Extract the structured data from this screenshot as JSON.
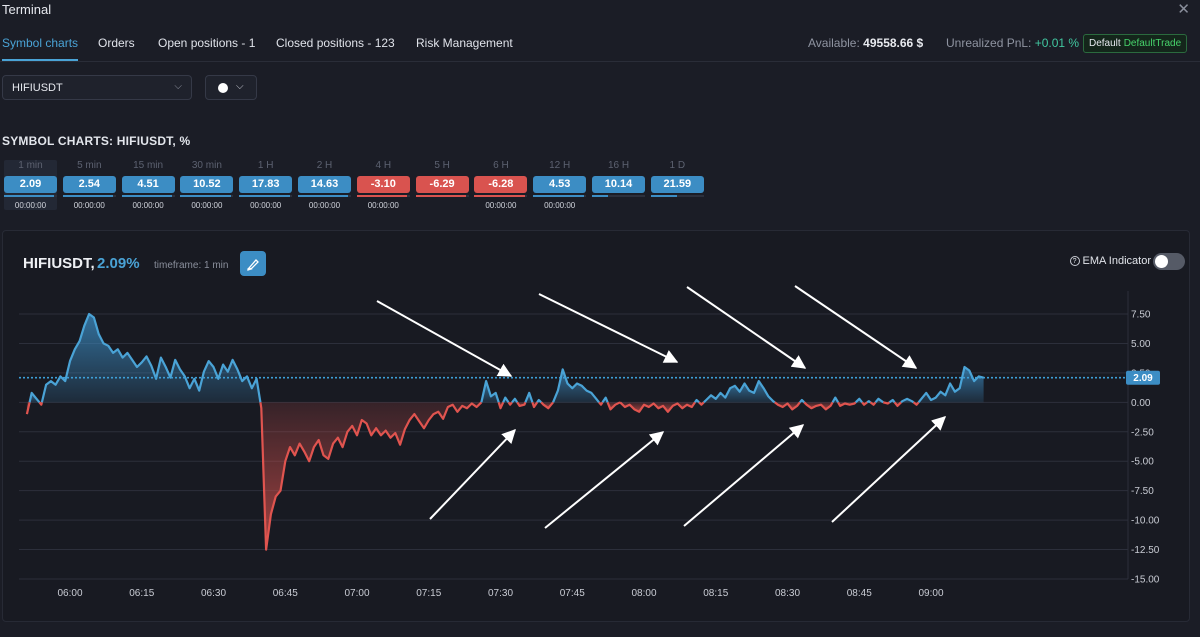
{
  "window": {
    "title": "Terminal"
  },
  "tabs": [
    {
      "label": "Symbol charts",
      "active": true
    },
    {
      "label": "Orders",
      "active": false
    },
    {
      "label": "Open positions - 1",
      "active": false
    },
    {
      "label": "Closed positions - 123",
      "active": false
    },
    {
      "label": "Risk Management",
      "active": false
    }
  ],
  "account": {
    "available_label": "Available:",
    "available_value": "49558.66 $",
    "pnl_label": "Unrealized PnL:",
    "pnl_value": "+0.01 %",
    "badge_default": "Default",
    "badge_trade": "DefaultTrade"
  },
  "symbol_select": {
    "value": "HIFIUSDT"
  },
  "section_title": "SYMBOL CHARTS: HIFIUSDT, %",
  "timeframes": [
    {
      "label": "1 min",
      "value": "2.09",
      "time": "00:00:00",
      "sign": "pos",
      "fill": 0.95
    },
    {
      "label": "5 min",
      "value": "2.54",
      "time": "00:00:00",
      "sign": "pos",
      "fill": 0.95
    },
    {
      "label": "15 min",
      "value": "4.51",
      "time": "00:00:00",
      "sign": "pos",
      "fill": 0.95
    },
    {
      "label": "30 min",
      "value": "10.52",
      "time": "00:00:00",
      "sign": "pos",
      "fill": 0.95
    },
    {
      "label": "1 H",
      "value": "17.83",
      "time": "00:00:00",
      "sign": "pos",
      "fill": 0.95
    },
    {
      "label": "2 H",
      "value": "14.63",
      "time": "00:00:00",
      "sign": "pos",
      "fill": 0.95
    },
    {
      "label": "4 H",
      "value": "-3.10",
      "time": "00:00:00",
      "sign": "neg",
      "fill": 0.95
    },
    {
      "label": "5 H",
      "value": "-6.29",
      "time": "",
      "sign": "neg",
      "fill": 0.95
    },
    {
      "label": "6 H",
      "value": "-6.28",
      "time": "00:00:00",
      "sign": "neg",
      "fill": 0.95
    },
    {
      "label": "12 H",
      "value": "4.53",
      "time": "00:00:00",
      "sign": "pos",
      "fill": 0.95
    },
    {
      "label": "16 H",
      "value": "10.14",
      "time": "",
      "sign": "pos",
      "fill": 0.3
    },
    {
      "label": "1 D",
      "value": "21.59",
      "time": "",
      "sign": "pos",
      "fill": 0.5
    }
  ],
  "chart_header": {
    "symbol": "HIFIUSDT,",
    "percent": "2.09%",
    "timeframe_label": "timeframe: 1 min",
    "ema_label": "EMA Indicator"
  },
  "colors": {
    "accent": "#3c8dc4",
    "positive": "#4aa3d6",
    "negative": "#e0544f",
    "pnl_positive": "#41c7a0"
  },
  "icons": [
    "close-icon",
    "chevron-down-icon",
    "pen-icon",
    "help-icon"
  ],
  "chart_data": {
    "type": "area",
    "title": "",
    "xlabel": "",
    "ylabel": "",
    "ylim": [
      -15,
      7.5
    ],
    "yticks": [
      "7.50",
      "5.00",
      "2.50",
      "0.00",
      "-2.50",
      "-5.00",
      "-7.50",
      "-10.00",
      "-12.50",
      "-15.00"
    ],
    "xticks": [
      "06:00",
      "06:15",
      "06:30",
      "06:45",
      "07:00",
      "07:15",
      "07:30",
      "07:45",
      "08:00",
      "08:15",
      "08:30",
      "08:45",
      "09:00"
    ],
    "current_value": 2.09,
    "current_label": "2.09",
    "grid": true,
    "series": [
      {
        "values": [
          {
            "t": "05:51",
            "v": -1.0
          },
          {
            "t": "05:52",
            "v": 0.8
          },
          {
            "t": "05:53",
            "v": 0.3
          },
          {
            "t": "05:54",
            "v": -0.2
          },
          {
            "t": "05:55",
            "v": 1.5
          },
          {
            "t": "05:56",
            "v": 1.8
          },
          {
            "t": "05:57",
            "v": 1.5
          },
          {
            "t": "05:58",
            "v": 2.2
          },
          {
            "t": "05:59",
            "v": 1.8
          },
          {
            "t": "06:00",
            "v": 3.5
          },
          {
            "t": "06:01",
            "v": 4.5
          },
          {
            "t": "06:02",
            "v": 5.2
          },
          {
            "t": "06:03",
            "v": 6.5
          },
          {
            "t": "06:04",
            "v": 7.5
          },
          {
            "t": "06:05",
            "v": 7.2
          },
          {
            "t": "06:06",
            "v": 5.8
          },
          {
            "t": "06:07",
            "v": 5.0
          },
          {
            "t": "06:08",
            "v": 4.8
          },
          {
            "t": "06:09",
            "v": 4.2
          },
          {
            "t": "06:10",
            "v": 4.5
          },
          {
            "t": "06:11",
            "v": 3.8
          },
          {
            "t": "06:12",
            "v": 4.2
          },
          {
            "t": "06:13",
            "v": 3.6
          },
          {
            "t": "06:14",
            "v": 3.0
          },
          {
            "t": "06:15",
            "v": 3.4
          },
          {
            "t": "06:16",
            "v": 3.9
          },
          {
            "t": "06:17",
            "v": 3.1
          },
          {
            "t": "06:18",
            "v": 2.0
          },
          {
            "t": "06:19",
            "v": 3.8
          },
          {
            "t": "06:20",
            "v": 3.0
          },
          {
            "t": "06:21",
            "v": 2.1
          },
          {
            "t": "06:22",
            "v": 3.6
          },
          {
            "t": "06:23",
            "v": 2.8
          },
          {
            "t": "06:24",
            "v": 2.2
          },
          {
            "t": "06:25",
            "v": 1.2
          },
          {
            "t": "06:26",
            "v": 2.0
          },
          {
            "t": "06:27",
            "v": 1.0
          },
          {
            "t": "06:28",
            "v": 2.6
          },
          {
            "t": "06:29",
            "v": 3.5
          },
          {
            "t": "06:30",
            "v": 3.0
          },
          {
            "t": "06:31",
            "v": 2.0
          },
          {
            "t": "06:32",
            "v": 3.2
          },
          {
            "t": "06:33",
            "v": 2.6
          },
          {
            "t": "06:34",
            "v": 3.6
          },
          {
            "t": "06:35",
            "v": 2.8
          },
          {
            "t": "06:36",
            "v": 1.8
          },
          {
            "t": "06:37",
            "v": 2.2
          },
          {
            "t": "06:38",
            "v": 1.2
          },
          {
            "t": "06:39",
            "v": 2.0
          },
          {
            "t": "06:40",
            "v": -0.5
          },
          {
            "t": "06:41",
            "v": -12.5
          },
          {
            "t": "06:42",
            "v": -9.5
          },
          {
            "t": "06:43",
            "v": -8.0
          },
          {
            "t": "06:44",
            "v": -7.5
          },
          {
            "t": "06:45",
            "v": -5.0
          },
          {
            "t": "06:46",
            "v": -3.8
          },
          {
            "t": "06:47",
            "v": -4.5
          },
          {
            "t": "06:48",
            "v": -3.5
          },
          {
            "t": "06:49",
            "v": -4.2
          },
          {
            "t": "06:50",
            "v": -5.0
          },
          {
            "t": "06:51",
            "v": -3.8
          },
          {
            "t": "06:52",
            "v": -3.2
          },
          {
            "t": "06:53",
            "v": -4.5
          },
          {
            "t": "06:54",
            "v": -4.8
          },
          {
            "t": "06:55",
            "v": -3.5
          },
          {
            "t": "06:56",
            "v": -3.0
          },
          {
            "t": "06:57",
            "v": -3.8
          },
          {
            "t": "06:58",
            "v": -2.5
          },
          {
            "t": "06:59",
            "v": -2.0
          },
          {
            "t": "07:00",
            "v": -2.8
          },
          {
            "t": "07:01",
            "v": -1.5
          },
          {
            "t": "07:02",
            "v": -1.8
          },
          {
            "t": "07:03",
            "v": -2.8
          },
          {
            "t": "07:04",
            "v": -2.2
          },
          {
            "t": "07:05",
            "v": -2.8
          },
          {
            "t": "07:06",
            "v": -2.4
          },
          {
            "t": "07:07",
            "v": -3.0
          },
          {
            "t": "07:08",
            "v": -2.6
          },
          {
            "t": "07:09",
            "v": -3.6
          },
          {
            "t": "07:10",
            "v": -2.3
          },
          {
            "t": "07:11",
            "v": -1.5
          },
          {
            "t": "07:12",
            "v": -1.0
          },
          {
            "t": "07:13",
            "v": -1.6
          },
          {
            "t": "07:14",
            "v": -2.2
          },
          {
            "t": "07:15",
            "v": -1.5
          },
          {
            "t": "07:16",
            "v": -1.0
          },
          {
            "t": "07:17",
            "v": -0.8
          },
          {
            "t": "07:18",
            "v": -1.4
          },
          {
            "t": "07:19",
            "v": -0.4
          },
          {
            "t": "07:20",
            "v": -0.2
          },
          {
            "t": "07:21",
            "v": -0.8
          },
          {
            "t": "07:22",
            "v": -0.3
          },
          {
            "t": "07:23",
            "v": -0.5
          },
          {
            "t": "07:24",
            "v": -0.1
          },
          {
            "t": "07:25",
            "v": -0.4
          },
          {
            "t": "07:26",
            "v": 0.0
          },
          {
            "t": "07:27",
            "v": 1.8
          },
          {
            "t": "07:28",
            "v": 0.5
          },
          {
            "t": "07:29",
            "v": 0.8
          },
          {
            "t": "07:30",
            "v": -0.5
          },
          {
            "t": "07:31",
            "v": 0.4
          },
          {
            "t": "07:32",
            "v": -0.2
          },
          {
            "t": "07:33",
            "v": 0.3
          },
          {
            "t": "07:34",
            "v": -0.3
          },
          {
            "t": "07:35",
            "v": -0.2
          },
          {
            "t": "07:36",
            "v": 0.8
          },
          {
            "t": "07:37",
            "v": -0.4
          },
          {
            "t": "07:38",
            "v": 0.2
          },
          {
            "t": "07:39",
            "v": -0.2
          },
          {
            "t": "07:40",
            "v": -0.5
          },
          {
            "t": "07:41",
            "v": 0.0
          },
          {
            "t": "07:42",
            "v": 1.0
          },
          {
            "t": "07:43",
            "v": 2.8
          },
          {
            "t": "07:44",
            "v": 1.6
          },
          {
            "t": "07:45",
            "v": 1.2
          },
          {
            "t": "07:46",
            "v": 1.6
          },
          {
            "t": "07:47",
            "v": 1.4
          },
          {
            "t": "07:48",
            "v": 1.0
          },
          {
            "t": "07:49",
            "v": 0.8
          },
          {
            "t": "07:50",
            "v": 0.3
          },
          {
            "t": "07:51",
            "v": -0.2
          },
          {
            "t": "07:52",
            "v": 0.4
          },
          {
            "t": "07:53",
            "v": -0.6
          },
          {
            "t": "07:54",
            "v": -0.2
          },
          {
            "t": "07:55",
            "v": 0.0
          },
          {
            "t": "07:56",
            "v": -0.4
          },
          {
            "t": "07:57",
            "v": -0.2
          },
          {
            "t": "07:58",
            "v": -0.6
          },
          {
            "t": "07:59",
            "v": -0.8
          },
          {
            "t": "08:00",
            "v": -0.2
          },
          {
            "t": "08:01",
            "v": -0.4
          },
          {
            "t": "08:02",
            "v": -0.1
          },
          {
            "t": "08:03",
            "v": -0.5
          },
          {
            "t": "08:04",
            "v": -0.3
          },
          {
            "t": "08:05",
            "v": -0.8
          },
          {
            "t": "08:06",
            "v": -0.3
          },
          {
            "t": "08:07",
            "v": -0.1
          },
          {
            "t": "08:08",
            "v": -0.5
          },
          {
            "t": "08:09",
            "v": -0.2
          },
          {
            "t": "08:10",
            "v": -0.4
          },
          {
            "t": "08:11",
            "v": 0.2
          },
          {
            "t": "08:12",
            "v": -0.2
          },
          {
            "t": "08:13",
            "v": 0.2
          },
          {
            "t": "08:14",
            "v": 0.6
          },
          {
            "t": "08:15",
            "v": 0.3
          },
          {
            "t": "08:16",
            "v": 0.8
          },
          {
            "t": "08:17",
            "v": 0.4
          },
          {
            "t": "08:18",
            "v": 1.2
          },
          {
            "t": "08:19",
            "v": 1.4
          },
          {
            "t": "08:20",
            "v": 0.9
          },
          {
            "t": "08:21",
            "v": 1.6
          },
          {
            "t": "08:22",
            "v": 1.0
          },
          {
            "t": "08:23",
            "v": 0.8
          },
          {
            "t": "08:24",
            "v": 1.8
          },
          {
            "t": "08:25",
            "v": 1.2
          },
          {
            "t": "08:26",
            "v": 0.5
          },
          {
            "t": "08:27",
            "v": 0.1
          },
          {
            "t": "08:28",
            "v": -0.2
          },
          {
            "t": "08:29",
            "v": -0.4
          },
          {
            "t": "08:30",
            "v": -0.1
          },
          {
            "t": "08:31",
            "v": -0.6
          },
          {
            "t": "08:32",
            "v": -0.3
          },
          {
            "t": "08:33",
            "v": 0.2
          },
          {
            "t": "08:34",
            "v": -0.2
          },
          {
            "t": "08:35",
            "v": -0.5
          },
          {
            "t": "08:36",
            "v": -0.3
          },
          {
            "t": "08:37",
            "v": -0.2
          },
          {
            "t": "08:38",
            "v": -0.6
          },
          {
            "t": "08:39",
            "v": -0.3
          },
          {
            "t": "08:40",
            "v": 0.4
          },
          {
            "t": "08:41",
            "v": -0.3
          },
          {
            "t": "08:42",
            "v": -0.1
          },
          {
            "t": "08:43",
            "v": -0.2
          },
          {
            "t": "08:44",
            "v": -0.1
          },
          {
            "t": "08:45",
            "v": 0.3
          },
          {
            "t": "08:46",
            "v": -0.2
          },
          {
            "t": "08:47",
            "v": 0.1
          },
          {
            "t": "08:48",
            "v": -0.2
          },
          {
            "t": "08:49",
            "v": 0.3
          },
          {
            "t": "08:50",
            "v": 0.0
          },
          {
            "t": "08:51",
            "v": -0.1
          },
          {
            "t": "08:52",
            "v": 0.2
          },
          {
            "t": "08:53",
            "v": -0.3
          },
          {
            "t": "08:54",
            "v": 0.1
          },
          {
            "t": "08:55",
            "v": 0.3
          },
          {
            "t": "08:56",
            "v": 0.1
          },
          {
            "t": "08:57",
            "v": -0.2
          },
          {
            "t": "08:58",
            "v": 0.3
          },
          {
            "t": "08:59",
            "v": 0.8
          },
          {
            "t": "09:00",
            "v": 0.2
          },
          {
            "t": "09:01",
            "v": 0.4
          },
          {
            "t": "09:02",
            "v": 0.9
          },
          {
            "t": "09:03",
            "v": 0.6
          },
          {
            "t": "09:04",
            "v": 1.6
          },
          {
            "t": "09:05",
            "v": 0.9
          },
          {
            "t": "09:06",
            "v": 1.2
          },
          {
            "t": "09:07",
            "v": 3.0
          },
          {
            "t": "09:08",
            "v": 2.7
          },
          {
            "t": "09:09",
            "v": 1.8
          },
          {
            "t": "09:10",
            "v": 2.2
          },
          {
            "t": "09:11",
            "v": 2.09
          }
        ]
      }
    ]
  }
}
